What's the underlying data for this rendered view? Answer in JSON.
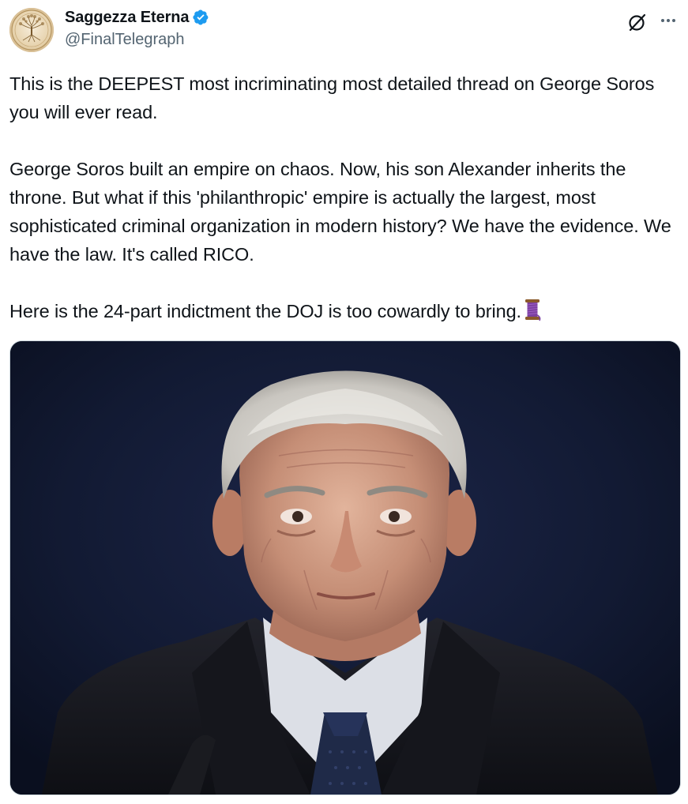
{
  "author": {
    "display_name": "Saggezza Eterna",
    "handle": "@FinalTelegraph",
    "verified": true,
    "verified_color": "#1d9bf0",
    "avatar_icon": "tree-of-life-avatar"
  },
  "actions": {
    "grok_icon": "grok-icon",
    "more_icon": "more-options-icon"
  },
  "tweet": {
    "paragraph_1": "This is the DEEPEST most incriminating most detailed thread on George Soros you will ever read.",
    "paragraph_2": "George Soros built an empire on chaos. Now, his son Alexander inherits the throne. But what if this 'philanthropic' empire is actually the largest, most sophisticated criminal organization in modern history? We have the evidence. We have the law. It's called RICO.",
    "paragraph_3": "Here is the 24-part indictment the DOJ is too cowardly to bring.",
    "thread_emoji": "thread-spool-emoji"
  },
  "media": {
    "type": "photo",
    "background_color": "#111830"
  },
  "colors": {
    "text": "#0f1419",
    "secondary_text": "#536471",
    "border": "#cfd9de"
  }
}
